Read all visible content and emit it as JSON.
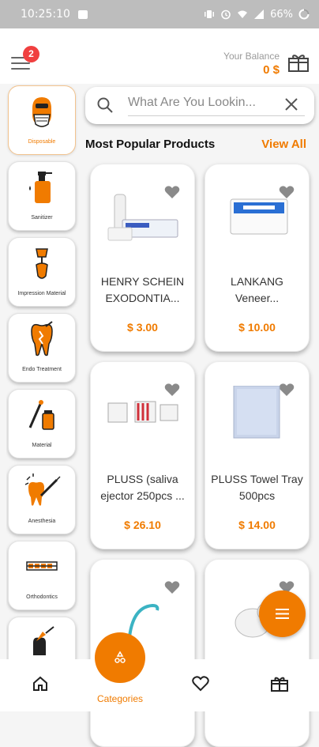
{
  "status_bar": {
    "time": "10:25:10",
    "battery": "66%"
  },
  "header": {
    "notification_count": "2",
    "balance_label": "Your Balance",
    "balance_value": "0 $"
  },
  "search": {
    "placeholder": "What Are You Lookin..."
  },
  "section": {
    "title": "Most Popular Products",
    "view_all": "View All"
  },
  "categories": [
    {
      "label": "Disposable",
      "icon": "mask-icon"
    },
    {
      "label": "Sanitizer",
      "icon": "sanitizer-icon"
    },
    {
      "label": "Impression Material",
      "icon": "impression-icon"
    },
    {
      "label": "Endo Treatment",
      "icon": "tooth-icon"
    },
    {
      "label": "Material",
      "icon": "material-icon"
    },
    {
      "label": "Anesthesia",
      "icon": "syringe-icon"
    },
    {
      "label": "Orthodontics",
      "icon": "braces-icon"
    },
    {
      "label": "",
      "icon": "tooth-tool-icon"
    }
  ],
  "products": [
    {
      "name": "HENRY SCHEIN EXODONTIA...",
      "price": "$ 3.00"
    },
    {
      "name": "LANKANG Veneer...",
      "price": "$ 10.00"
    },
    {
      "name": "PLUSS (saliva ejector 250pcs ...",
      "price": "$ 26.10"
    },
    {
      "name": "PLUSS Towel Tray 500pcs",
      "price": "$ 14.00"
    },
    {
      "name": "",
      "price": ""
    },
    {
      "name": "",
      "price": ""
    }
  ],
  "bottom_nav": {
    "categories_label": "Categories"
  },
  "colors": {
    "accent": "#f07b00",
    "badge": "#f04040"
  }
}
